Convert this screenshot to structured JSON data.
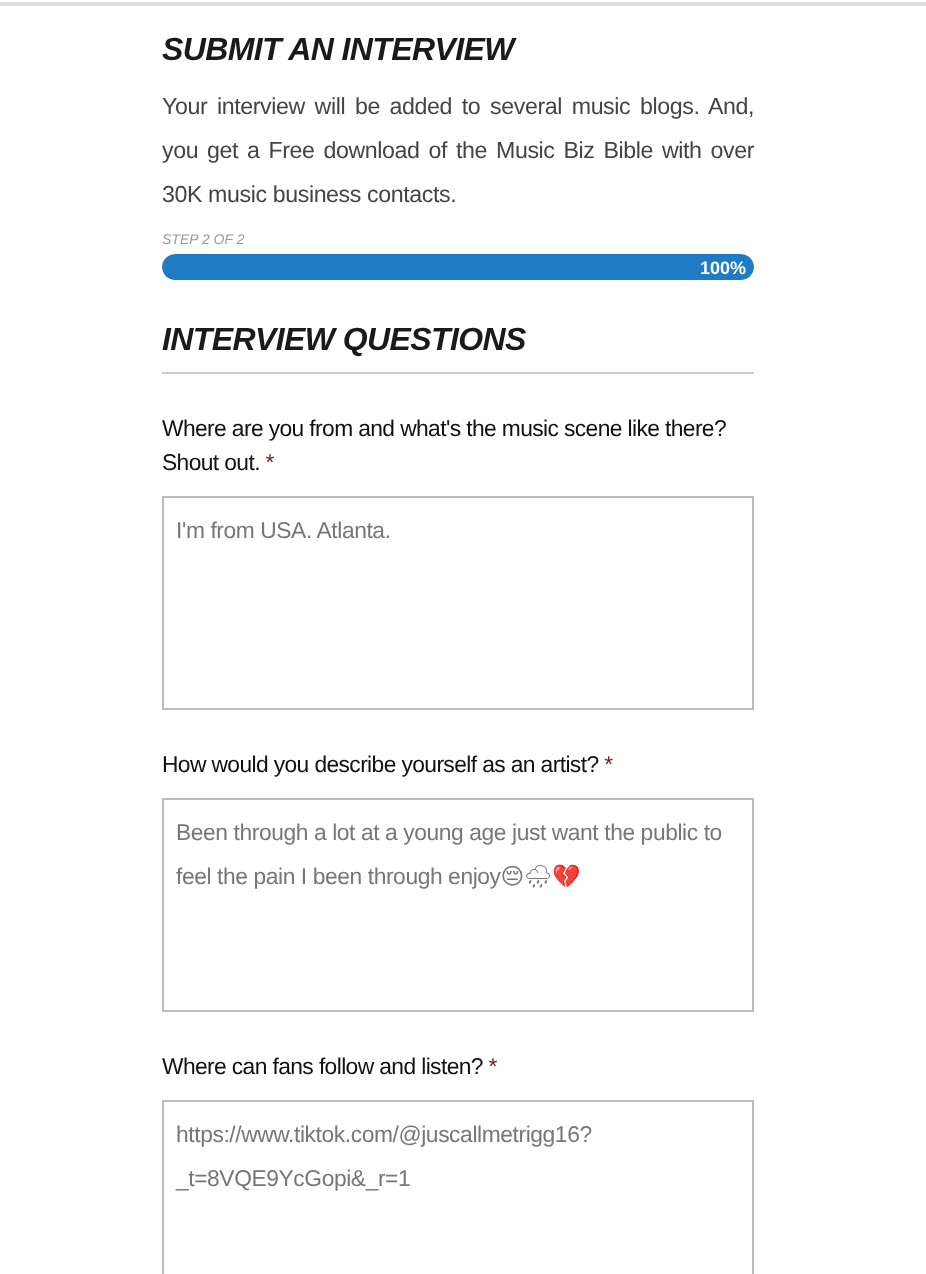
{
  "title": "SUBMIT AN INTERVIEW",
  "intro": "Your interview will be added to several music blogs. And, you get a Free download of the Music Biz Bible with over 30K music business contacts.",
  "progress": {
    "step": "STEP 2 OF 2",
    "level": 1,
    "reading": "100%"
  },
  "section_title": "INTERVIEW QUESTIONS",
  "questions": [
    {
      "label": "Where are you from and what's the music scene like there? Shout out.",
      "required_mark": "*",
      "value": "I'm from USA. Atlanta."
    },
    {
      "label": "How would you describe yourself as an artist?",
      "required_mark": "*",
      "value": "Been through a lot at a young age just want the public to feel the pain I been through enjoy😔🌧💔"
    },
    {
      "label": "Where can fans follow and listen?",
      "required_mark": "*",
      "value": "https://www.tiktok.com/@juscallmetrigg16?_t=8VQE9YcGopi&_r=1"
    }
  ]
}
